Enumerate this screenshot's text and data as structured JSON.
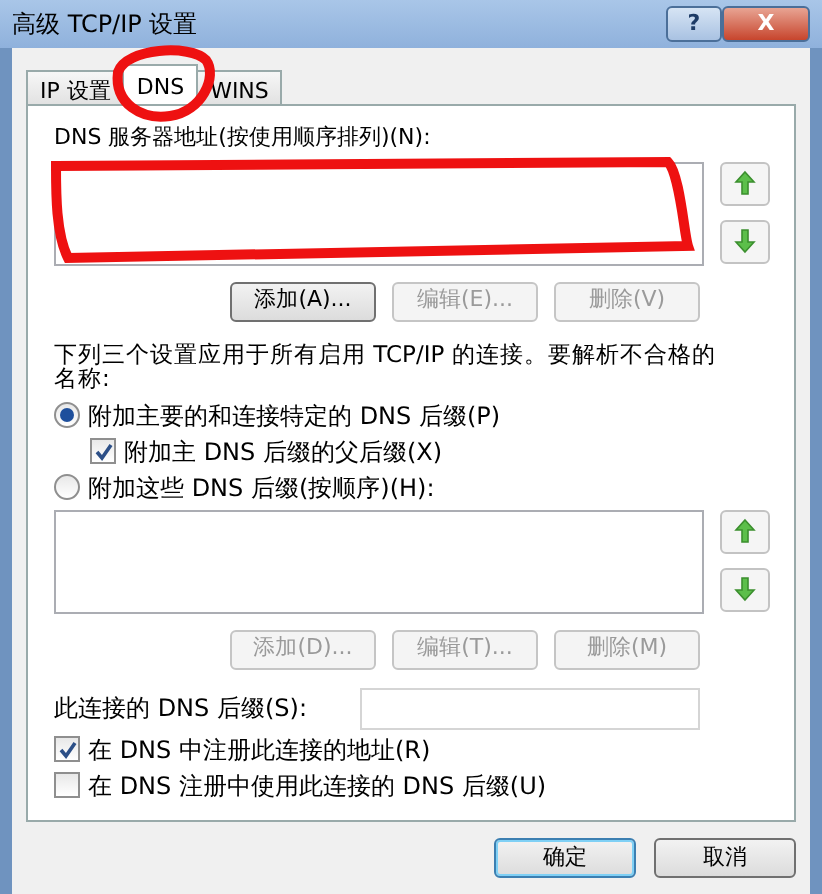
{
  "window": {
    "title": "高级 TCP/IP 设置",
    "controls": [
      {
        "kind": "help",
        "label": "?"
      },
      {
        "kind": "close",
        "label": "X"
      }
    ]
  },
  "tabs": [
    {
      "label": "IP 设置",
      "selected": false
    },
    {
      "label": "DNS",
      "selected": true
    },
    {
      "label": "WINS",
      "selected": false
    }
  ],
  "dns_servers": {
    "label": "DNS 服务器地址(按使用顺序排列)(N):",
    "buttons": [
      {
        "label": "添加(A)...",
        "disabled": false
      },
      {
        "label": "编辑(E)...",
        "disabled": true
      },
      {
        "label": "删除(V)",
        "disabled": true
      }
    ]
  },
  "note": "下列三个设置应用于所有启用 TCP/IP 的连接。要解析不合格的名称:",
  "options": [
    {
      "kind": "radio",
      "label": "附加主要的和连接特定的 DNS 后缀(P)",
      "checked": true,
      "indent": false
    },
    {
      "kind": "checkbox",
      "label": "附加主 DNS 后缀的父后缀(X)",
      "checked": true,
      "indent": true
    },
    {
      "kind": "radio",
      "label": "附加这些 DNS 后缀(按顺序)(H):",
      "checked": false,
      "indent": false
    }
  ],
  "suffixes": {
    "buttons": [
      {
        "label": "添加(D)...",
        "disabled": true
      },
      {
        "label": "编辑(T)...",
        "disabled": true
      },
      {
        "label": "删除(M)",
        "disabled": true
      }
    ]
  },
  "connection_suffix": {
    "label": "此连接的 DNS 后缀(S):"
  },
  "checkboxes": [
    {
      "label": "在 DNS 中注册此连接的地址(R)",
      "checked": true
    },
    {
      "label": "在 DNS 注册中使用此连接的 DNS 后缀(U)",
      "checked": false
    }
  ],
  "buttons": [
    {
      "label": "确定",
      "default": true
    },
    {
      "label": "取消",
      "default": false
    }
  ],
  "annotations": [
    {
      "kind": "circle",
      "color": "#ee1111"
    },
    {
      "kind": "box",
      "color": "#ee1111"
    }
  ]
}
